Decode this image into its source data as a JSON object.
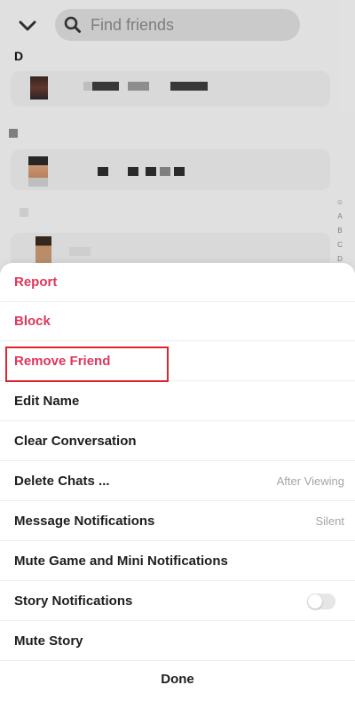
{
  "background": {
    "search": {
      "placeholder": "Find friends"
    },
    "section_letter": "D",
    "alpha_index": [
      "☺",
      "A",
      "B",
      "C",
      "D"
    ]
  },
  "sheet": {
    "items": [
      {
        "label": "Report",
        "style": "danger"
      },
      {
        "label": "Block",
        "style": "danger"
      },
      {
        "label": "Remove Friend",
        "style": "danger",
        "highlighted": true
      },
      {
        "label": "Edit Name"
      },
      {
        "label": "Clear Conversation"
      },
      {
        "label": "Delete Chats ...",
        "value": "After Viewing"
      },
      {
        "label": "Message Notifications",
        "value": "Silent"
      },
      {
        "label": "Mute Game and Mini Notifications"
      },
      {
        "label": "Story Notifications",
        "toggle": false
      },
      {
        "label": "Mute Story"
      }
    ],
    "done_label": "Done"
  },
  "colors": {
    "danger": "#e0365a",
    "highlight_border": "#e0242b",
    "text": "#1d1d1d",
    "secondary_text": "#a5a5a5"
  }
}
